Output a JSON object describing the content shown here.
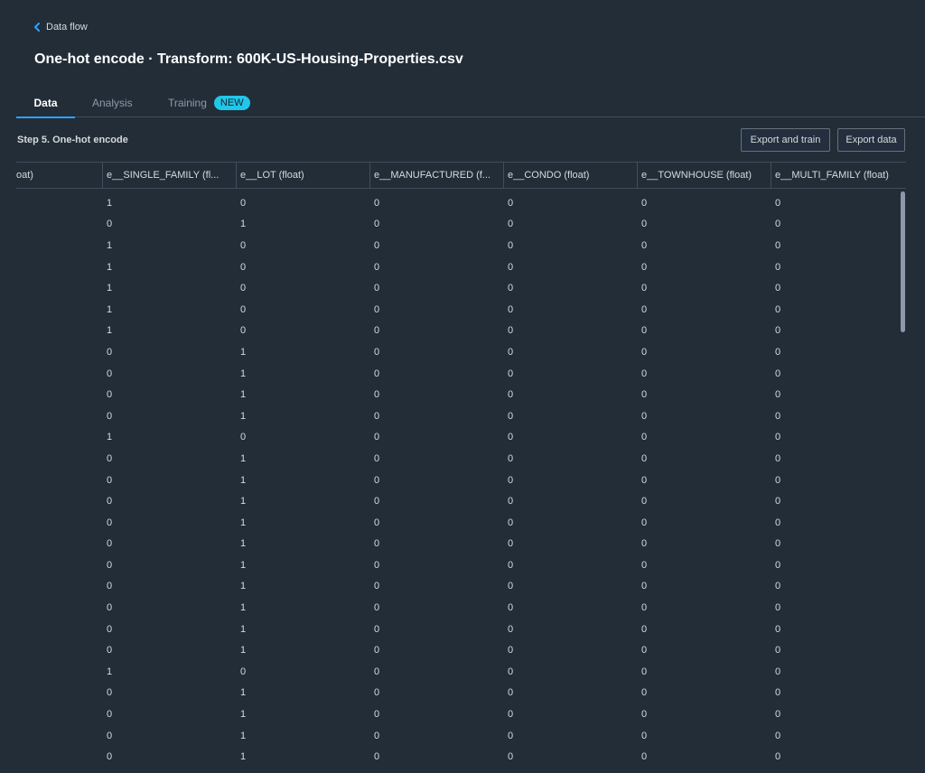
{
  "header": {
    "back_label": "Data flow",
    "title": "One-hot encode · Transform: 600K-US-Housing-Properties.csv"
  },
  "tabs": [
    {
      "label": "Data",
      "active": true
    },
    {
      "label": "Analysis",
      "active": false
    },
    {
      "label": "Training",
      "active": false,
      "badge": "NEW"
    }
  ],
  "step": {
    "title": "Step 5. One-hot encode",
    "export_train_label": "Export and train",
    "export_data_label": "Export data"
  },
  "table": {
    "columns": [
      "oat)",
      "e__SINGLE_FAMILY (fl...",
      "e__LOT (float)",
      "e__MANUFACTURED (f...",
      "e__CONDO (float)",
      "e__TOWNHOUSE (float)",
      "e__MULTI_FAMILY (float)"
    ],
    "rows": [
      [
        "",
        "1",
        "0",
        "0",
        "0",
        "0",
        "0"
      ],
      [
        "",
        "0",
        "1",
        "0",
        "0",
        "0",
        "0"
      ],
      [
        "",
        "1",
        "0",
        "0",
        "0",
        "0",
        "0"
      ],
      [
        "",
        "1",
        "0",
        "0",
        "0",
        "0",
        "0"
      ],
      [
        "",
        "1",
        "0",
        "0",
        "0",
        "0",
        "0"
      ],
      [
        "",
        "1",
        "0",
        "0",
        "0",
        "0",
        "0"
      ],
      [
        "",
        "1",
        "0",
        "0",
        "0",
        "0",
        "0"
      ],
      [
        "",
        "0",
        "1",
        "0",
        "0",
        "0",
        "0"
      ],
      [
        "",
        "0",
        "1",
        "0",
        "0",
        "0",
        "0"
      ],
      [
        "",
        "0",
        "1",
        "0",
        "0",
        "0",
        "0"
      ],
      [
        "",
        "0",
        "1",
        "0",
        "0",
        "0",
        "0"
      ],
      [
        "",
        "1",
        "0",
        "0",
        "0",
        "0",
        "0"
      ],
      [
        "",
        "0",
        "1",
        "0",
        "0",
        "0",
        "0"
      ],
      [
        "",
        "0",
        "1",
        "0",
        "0",
        "0",
        "0"
      ],
      [
        "",
        "0",
        "1",
        "0",
        "0",
        "0",
        "0"
      ],
      [
        "",
        "0",
        "1",
        "0",
        "0",
        "0",
        "0"
      ],
      [
        "",
        "0",
        "1",
        "0",
        "0",
        "0",
        "0"
      ],
      [
        "",
        "0",
        "1",
        "0",
        "0",
        "0",
        "0"
      ],
      [
        "",
        "0",
        "1",
        "0",
        "0",
        "0",
        "0"
      ],
      [
        "",
        "0",
        "1",
        "0",
        "0",
        "0",
        "0"
      ],
      [
        "",
        "0",
        "1",
        "0",
        "0",
        "0",
        "0"
      ],
      [
        "",
        "0",
        "1",
        "0",
        "0",
        "0",
        "0"
      ],
      [
        "",
        "1",
        "0",
        "0",
        "0",
        "0",
        "0"
      ],
      [
        "",
        "0",
        "1",
        "0",
        "0",
        "0",
        "0"
      ],
      [
        "",
        "0",
        "1",
        "0",
        "0",
        "0",
        "0"
      ],
      [
        "",
        "0",
        "1",
        "0",
        "0",
        "0",
        "0"
      ],
      [
        "",
        "0",
        "1",
        "0",
        "0",
        "0",
        "0"
      ]
    ]
  },
  "colors": {
    "background": "#222d38",
    "accent": "#2ea2ff",
    "badge": "#21c7e8"
  },
  "icons": {
    "back": "chevron-left-icon"
  }
}
